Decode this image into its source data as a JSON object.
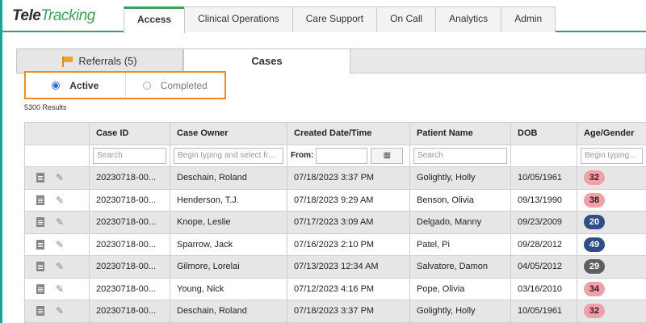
{
  "app": {
    "logo_tele": "Tele",
    "logo_tracking": "Tracking"
  },
  "nav": {
    "tabs": [
      {
        "label": "Access",
        "active": true
      },
      {
        "label": "Clinical Operations",
        "active": false
      },
      {
        "label": "Care Support",
        "active": false
      },
      {
        "label": "On Call",
        "active": false
      },
      {
        "label": "Analytics",
        "active": false
      },
      {
        "label": "Admin",
        "active": false
      }
    ]
  },
  "subtabs": {
    "referrals": {
      "label": "Referrals (5)",
      "icon": "flag-icon"
    },
    "cases": {
      "label": "Cases"
    }
  },
  "filter_status": {
    "active": {
      "label": "Active",
      "selected": true
    },
    "completed": {
      "label": "Completed",
      "selected": false
    }
  },
  "results": {
    "count_text": "5300 Results"
  },
  "table": {
    "columns": [
      "Case ID",
      "Case Owner",
      "Created Date/Time",
      "Patient Name",
      "DOB",
      "Age/Gender"
    ],
    "filters": {
      "case_id_placeholder": "Search",
      "owner_placeholder": "Begin typing and select fr...",
      "from_label": "From:",
      "patient_placeholder": "Search",
      "age_placeholder": "Begin typing..."
    },
    "rows": [
      {
        "case_id": "20230718-00...",
        "owner": "Deschain, Roland",
        "created": "07/18/2023 3:37 PM",
        "patient": "Golightly, Holly",
        "dob": "10/05/1961",
        "age": "32",
        "badge": "pink"
      },
      {
        "case_id": "20230718-00...",
        "owner": "Henderson, T.J.",
        "created": "07/18/2023 9:29 AM",
        "patient": "Benson, Olivia",
        "dob": "09/13/1990",
        "age": "38",
        "badge": "pink"
      },
      {
        "case_id": "20230718-00...",
        "owner": "Knope, Leslie",
        "created": "07/17/2023 3:09 AM",
        "patient": "Delgado, Manny",
        "dob": "09/23/2009",
        "age": "20",
        "badge": "navy"
      },
      {
        "case_id": "20230718-00...",
        "owner": "Sparrow, Jack",
        "created": "07/16/2023 2:10 PM",
        "patient": "Patel, Pi",
        "dob": "09/28/2012",
        "age": "49",
        "badge": "navy"
      },
      {
        "case_id": "20230718-00...",
        "owner": "Gilmore, Lorelai",
        "created": "07/13/2023 12:34 AM",
        "patient": "Salvatore, Damon",
        "dob": "04/05/2012",
        "age": "29",
        "badge": "gray"
      },
      {
        "case_id": "20230718-00...",
        "owner": "Young, Nick",
        "created": "07/12/2023 4:16 PM",
        "patient": "Pope, Olivia",
        "dob": "03/16/2010",
        "age": "34",
        "badge": "pink"
      },
      {
        "case_id": "20230718-00...",
        "owner": "Deschain, Roland",
        "created": "07/18/2023 3:37 PM",
        "patient": "Golightly, Holly",
        "dob": "10/05/1961",
        "age": "32",
        "badge": "pink"
      }
    ]
  },
  "colors": {
    "accent_green": "#3f9e5a",
    "highlight_orange": "#f08a1e",
    "radio_blue": "#2f6fd1",
    "badge_pink": "#f0a0a8",
    "badge_navy": "#2e4f86",
    "badge_gray": "#5f5f5f"
  }
}
